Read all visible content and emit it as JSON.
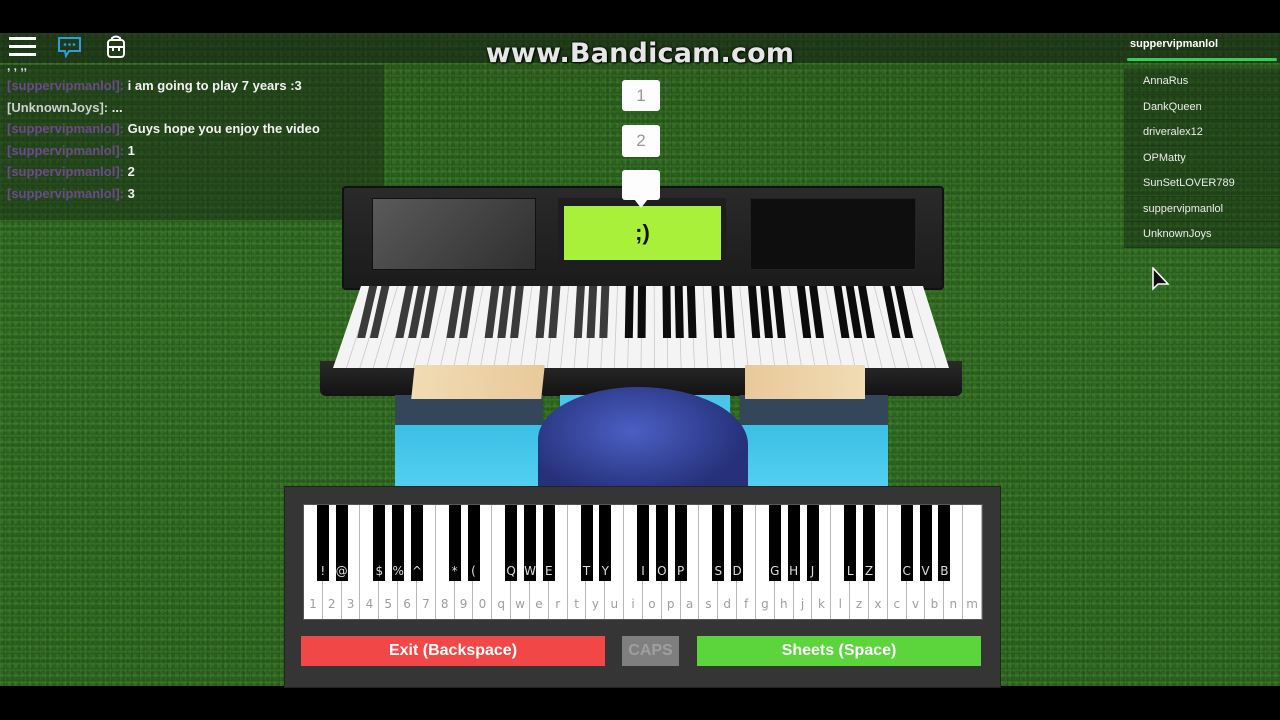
{
  "watermark": "www.Bandicam.com",
  "topbar": {
    "icons": [
      "menu-icon",
      "chat-icon",
      "backpack-icon"
    ]
  },
  "chat": {
    "clipped_top_line": ",  ,  ,,",
    "messages": [
      {
        "author": "[suppervipmanlol]:",
        "text": "i am going to play 7 years :3",
        "style": "purple"
      },
      {
        "author": "[UnknownJoys]:",
        "text": "...",
        "style": "plain"
      },
      {
        "author": "[suppervipmanlol]:",
        "text": "Guys hope you enjoy the video",
        "style": "purple"
      },
      {
        "author": "[suppervipmanlol]:",
        "text": "1",
        "style": "purple"
      },
      {
        "author": "[suppervipmanlol]:",
        "text": "2",
        "style": "purple"
      },
      {
        "author": "[suppervipmanlol]:",
        "text": "3",
        "style": "purple"
      }
    ]
  },
  "players": {
    "local_player": "suppervipmanlol",
    "list": [
      "AnnaRus",
      "DankQueen",
      "driveralex12",
      "OPMatty",
      "SunSetLOVER789",
      "suppervipmanlol",
      "UnknownJoys"
    ]
  },
  "bubbles": [
    "1",
    "2",
    ""
  ],
  "piano_screen_text": ";)",
  "keyboard": {
    "white_keys": [
      "1",
      "2",
      "3",
      "4",
      "5",
      "6",
      "7",
      "8",
      "9",
      "0",
      "q",
      "w",
      "e",
      "r",
      "t",
      "y",
      "u",
      "i",
      "o",
      "p",
      "a",
      "s",
      "d",
      "f",
      "g",
      "h",
      "j",
      "k",
      "l",
      "z",
      "x",
      "c",
      "v",
      "b",
      "n",
      "m"
    ],
    "black_keys": [
      {
        "after": 0,
        "label": "!"
      },
      {
        "after": 1,
        "label": "@"
      },
      {
        "after": 3,
        "label": "$"
      },
      {
        "after": 4,
        "label": "%"
      },
      {
        "after": 5,
        "label": "^"
      },
      {
        "after": 7,
        "label": "*"
      },
      {
        "after": 8,
        "label": "("
      },
      {
        "after": 10,
        "label": "Q"
      },
      {
        "after": 11,
        "label": "W"
      },
      {
        "after": 12,
        "label": "E"
      },
      {
        "after": 14,
        "label": "T"
      },
      {
        "after": 15,
        "label": "Y"
      },
      {
        "after": 17,
        "label": "I"
      },
      {
        "after": 18,
        "label": "O"
      },
      {
        "after": 19,
        "label": "P"
      },
      {
        "after": 21,
        "label": "S"
      },
      {
        "after": 22,
        "label": "D"
      },
      {
        "after": 24,
        "label": "G"
      },
      {
        "after": 25,
        "label": "H"
      },
      {
        "after": 26,
        "label": "J"
      },
      {
        "after": 28,
        "label": "L"
      },
      {
        "after": 29,
        "label": "Z"
      },
      {
        "after": 31,
        "label": "C"
      },
      {
        "after": 32,
        "label": "V"
      },
      {
        "after": 33,
        "label": "B"
      }
    ],
    "exit_label": "Exit (Backspace)",
    "caps_label": "CAPS",
    "sheets_label": "Sheets (Space)"
  },
  "colors": {
    "exit": "#f24747",
    "sheets": "#5cd43c",
    "caps": "#7f7f7f",
    "player_bar": "#2ed15a",
    "piano_screen": "#a8f03a",
    "chat_icon": "#2f9be0"
  }
}
